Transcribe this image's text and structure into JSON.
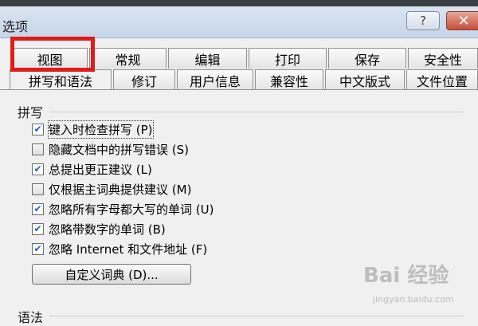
{
  "window": {
    "title": "选项",
    "help_label": "?",
    "close_label": "✕"
  },
  "tabs_row1": [
    "视图",
    "常规",
    "编辑",
    "打印",
    "保存",
    "安全性"
  ],
  "tabs_row2": [
    "拼写和语法",
    "修订",
    "用户信息",
    "兼容性",
    "中文版式",
    "文件位置"
  ],
  "spelling": {
    "title": "拼写",
    "options": [
      {
        "label": "键入时检查拼写 (P)",
        "checked": true
      },
      {
        "label": "隐藏文档中的拼写错误 (S)",
        "checked": false
      },
      {
        "label": "总提出更正建议 (L)",
        "checked": true
      },
      {
        "label": "仅根据主词典提供建议 (M)",
        "checked": false
      },
      {
        "label": "忽略所有字母都大写的单词 (U)",
        "checked": true
      },
      {
        "label": "忽略带数字的单词 (B)",
        "checked": true
      },
      {
        "label": "忽略 Internet 和文件地址 (F)",
        "checked": true
      }
    ],
    "custom_dict_button": "自定义词典 (D)..."
  },
  "grammar": {
    "title": "语法"
  },
  "watermark": {
    "text": "Bai 经验",
    "sub": "jingyan.baidu.com"
  }
}
